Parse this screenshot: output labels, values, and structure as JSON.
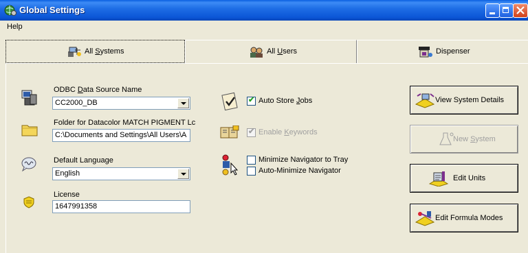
{
  "window": {
    "title": "Global Settings",
    "icons": {
      "app": "globe-gear-icon",
      "minimize": "minimize-icon",
      "maximize": "maximize-icon",
      "close": "close-icon"
    }
  },
  "menu": {
    "help": "Help"
  },
  "tabs": [
    {
      "label": "All Systems",
      "mnemonic": "S",
      "icon": "system-icon",
      "active": true
    },
    {
      "label": "All Users",
      "mnemonic": "U",
      "icon": "users-icon",
      "active": false
    },
    {
      "label": "Dispenser",
      "icon": "dispenser-icon",
      "active": false
    }
  ],
  "fields": {
    "odbc": {
      "label": "ODBC Data Source Name",
      "value": "CC2000_DB",
      "icon": "database-computer-icon"
    },
    "folder": {
      "label": "Folder for Datacolor MATCH PIGMENT Lc",
      "value": "C:\\Documents and Settings\\All Users\\A",
      "icon": "folder-icon"
    },
    "language": {
      "label": "Default Language",
      "value": "English",
      "icon": "speech-icon"
    },
    "license": {
      "label": "License",
      "value": "1647991358",
      "icon": "license-shield-icon"
    }
  },
  "options": {
    "auto_store_jobs": {
      "label": "Auto Store Jobs",
      "checked": true,
      "icon": "clipboard-check-icon"
    },
    "enable_keywords": {
      "label": "Enable Keywords",
      "checked": true,
      "disabled": true,
      "icon": "keywords-book-icon"
    },
    "minimize_tray": {
      "label": "Minimize Navigator to Tray",
      "checked": false,
      "icon": "navigator-icon"
    },
    "auto_minimize": {
      "label": "Auto-Minimize Navigator",
      "checked": false
    }
  },
  "buttons": {
    "view_system_details": {
      "label": "View System Details",
      "icon": "system-details-icon"
    },
    "new_system": {
      "label": "New System",
      "disabled": true,
      "icon": "flask-icon"
    },
    "edit_units": {
      "label": "Edit Units",
      "icon": "units-icon"
    },
    "edit_formula_modes": {
      "label": "Edit Formula Modes",
      "icon": "formula-icon"
    }
  }
}
